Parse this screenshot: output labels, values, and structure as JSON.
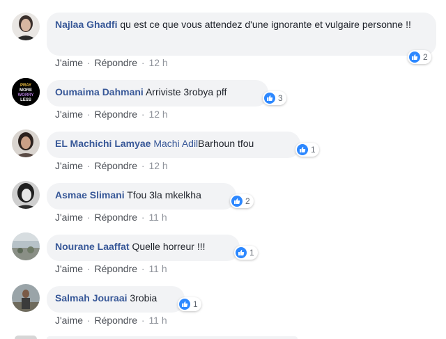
{
  "labels": {
    "like": "J'aime",
    "reply": "Répondre",
    "dot": "·"
  },
  "comments": [
    {
      "author": "Najlaa Ghadfi",
      "mention": "",
      "text": "qu est ce que vous attendez d'une ignorante et vulgaire personne !!",
      "likes": "2",
      "time": "12 h"
    },
    {
      "author": "Oumaima Dahmani",
      "mention": "",
      "text": "Arriviste 3robya pff",
      "likes": "3",
      "time": "12 h",
      "avatar_text": "PRAY MORE WORRY LESS"
    },
    {
      "author": "EL Machichi Lamyae",
      "mention": "Machi Adil",
      "text": "Barhoun tfou",
      "likes": "1",
      "time": "12 h"
    },
    {
      "author": "Asmae Slimani",
      "mention": "",
      "text": "Tfou 3la mkelkha",
      "likes": "2",
      "time": "11 h"
    },
    {
      "author": "Nourane Laaffat",
      "mention": "",
      "text": "Quelle horreur !!!",
      "likes": "1",
      "time": "11 h"
    },
    {
      "author": "Salmah Jouraai",
      "mention": "",
      "text": "3robia",
      "likes": "1",
      "time": "11 h"
    }
  ],
  "colors": {
    "author": "#385898",
    "bubble": "#f2f3f5",
    "like_badge": "#2d88ff",
    "meta": "#90949c"
  }
}
